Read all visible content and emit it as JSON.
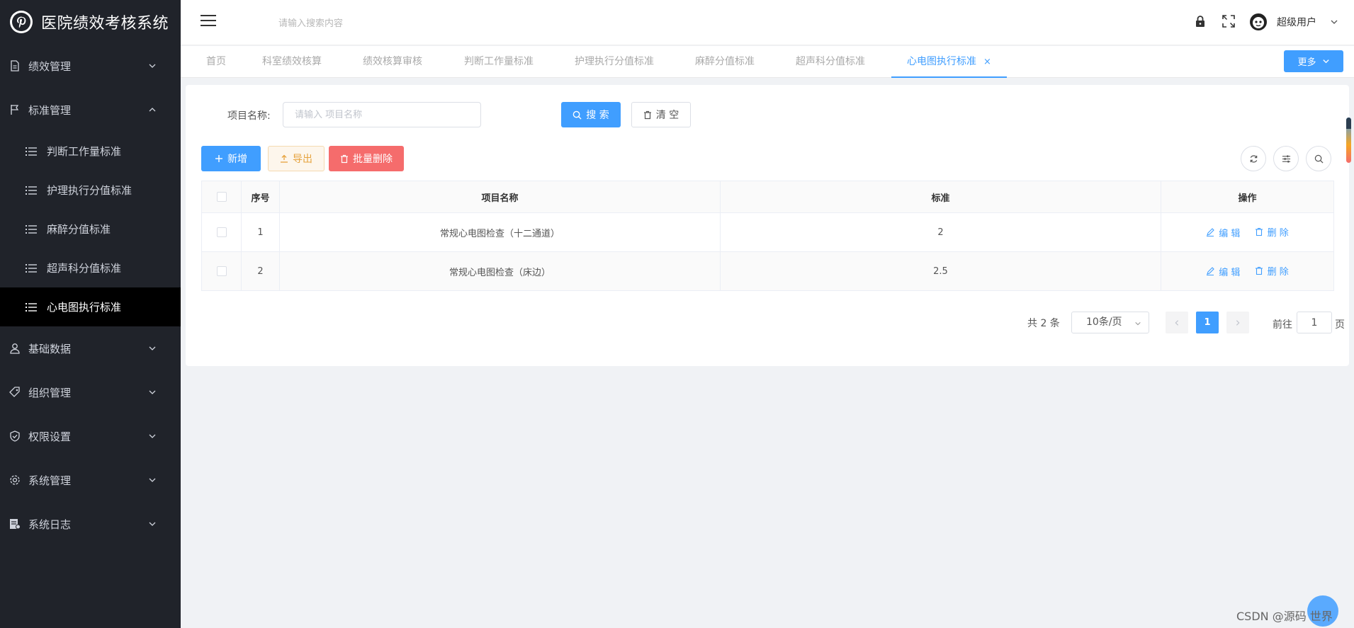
{
  "app": {
    "title": "医院绩效考核系统"
  },
  "header": {
    "search_placeholder": "请输入搜索内容",
    "user_name": "超级用户"
  },
  "sidebar": {
    "menus": [
      {
        "label": "绩效管理",
        "icon": "document-icon",
        "expanded": false
      },
      {
        "label": "标准管理",
        "icon": "flag-icon",
        "expanded": true,
        "children": [
          {
            "label": "判断工作量标准",
            "active": false
          },
          {
            "label": "护理执行分值标准",
            "active": false
          },
          {
            "label": "麻醉分值标准",
            "active": false
          },
          {
            "label": "超声科分值标准",
            "active": false
          },
          {
            "label": "心电图执行标准",
            "active": true
          }
        ]
      },
      {
        "label": "基础数据",
        "icon": "user-icon",
        "expanded": false
      },
      {
        "label": "组织管理",
        "icon": "tag-icon",
        "expanded": false
      },
      {
        "label": "权限设置",
        "icon": "shield-icon",
        "expanded": false
      },
      {
        "label": "系统管理",
        "icon": "gear-icon",
        "expanded": false
      },
      {
        "label": "系统日志",
        "icon": "log-icon",
        "expanded": false
      }
    ]
  },
  "tabs": {
    "items": [
      {
        "label": "首页",
        "active": false
      },
      {
        "label": "科室绩效核算",
        "active": false
      },
      {
        "label": "绩效核算审核",
        "active": false
      },
      {
        "label": "判断工作量标准",
        "active": false
      },
      {
        "label": "护理执行分值标准",
        "active": false
      },
      {
        "label": "麻醉分值标准",
        "active": false
      },
      {
        "label": "超声科分值标准",
        "active": false
      },
      {
        "label": "心电图执行标准",
        "active": true
      }
    ],
    "close_glyph": "×",
    "more_label": "更多"
  },
  "filter": {
    "label": "项目名称:",
    "placeholder": "请输入 项目名称",
    "value": "",
    "search_label": "搜 索",
    "clear_label": "清 空"
  },
  "toolbar": {
    "add_label": "新增",
    "export_label": "导出",
    "batch_delete_label": "批量删除"
  },
  "table": {
    "columns": [
      "序号",
      "项目名称",
      "标准",
      "操作"
    ],
    "rows": [
      {
        "index": "1",
        "name": "常规心电图检查（十二通道）",
        "standard": "2"
      },
      {
        "index": "2",
        "name": "常规心电图检查（床边）",
        "standard": "2.5"
      }
    ],
    "edit_label": "编 辑",
    "delete_label": "删 除"
  },
  "pagination": {
    "total_text": "共 2 条",
    "page_size": "10条/页",
    "current_page": "1",
    "goto_label": "前往",
    "goto_value": "1",
    "goto_unit": "页"
  },
  "watermark": "CSDN @源码 世界",
  "colors": {
    "primary": "#409eff",
    "danger": "#f56c6c",
    "warning": "#e6a23c",
    "sidebar_bg": "#20232a"
  }
}
